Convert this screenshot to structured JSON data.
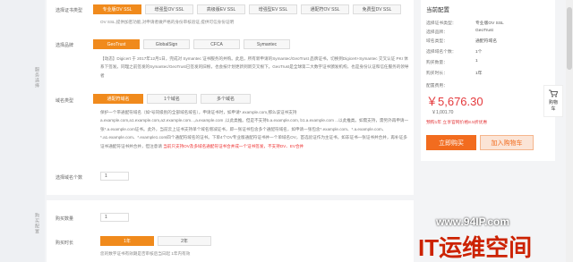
{
  "side": {
    "label_a": "服务选择",
    "label_b": "购买配置"
  },
  "cert_type": {
    "label": "选择证书类型",
    "options": [
      "专业版OV SSL",
      "增强型OV SSL",
      "高级版EV SSL",
      "增强型EV SSL",
      "通配符OV SSL",
      "免费型DV SSL"
    ],
    "selected": 0,
    "note": "OV SSL,提供加密功能,对申请者做严格的身份审核验证,提供可信身份证明"
  },
  "brand": {
    "label": "选择品牌",
    "options": [
      "GeoTrust",
      "GlobalSign",
      "CFCA",
      "Symantec"
    ],
    "selected": 0,
    "desc": "【动态】Digicert 于 2017年12月1日，完成对 Symantec 证书服务的并购。此后，所有新申请的Symantec/GeoTrust 品牌证书，切换到Digicert+Symantec 交叉认证 PKI 体系下签发。同理之前签发的Symantec/GeoTrust已签发的旧根，也会按计划更新到新交叉根下。GeoTrust是全球第二大数字证书颁发机构，也是身份认证和信任服务的领导者"
  },
  "domain_type": {
    "label": "域名类型",
    "options": [
      "通配符域名",
      "1个域名",
      "多个域名"
    ],
    "selected": 0,
    "desc_a": "保护一个带通配符域名（如*号同级别的全部域名域名），申请证书时，如申请*.example.com,那么该证书支持a.example.com,a1.example.com,a2.example.com...,a.example.com ,以此类推。但是不支持b.a.example.com, b1.a.example.com ...以此推类。如需支持，需另外再申请一张*.a.example.com证书。此外，当前云上证书支持单个域名增减证书，即一张证书包含多个通配符域名，如申请一张包含*.example.com、*.a.example.com、*.a1.example.com、*.example1.com四个通配符域名的证书。下单4个OV专业版通配符证书并一个单域名OV，首选验证作为主证书，如非证书一张证书并合并，再补证多证书通配符证书并合并，但注意请 ",
    "desc_red": "当前只支持OV及多域名通配符证书合并成一个证书签发，不支持DV、EV合并"
  },
  "domain_count": {
    "label": "选择域名个数",
    "value": "1"
  },
  "purchase_count": {
    "label": "购买数量",
    "value": "1"
  },
  "duration": {
    "label": "购买时长",
    "options": [
      "1年",
      "2年"
    ],
    "selected": 0,
    "note": "您的数字证书有效期是否审核后当日起 1年内有效"
  },
  "config": {
    "title": "当前配置",
    "rows": [
      {
        "k": "选择证书类型：",
        "v": "专业版OV SSL"
      },
      {
        "k": "选择品牌：",
        "v": "GeoTrust"
      },
      {
        "k": "域名类型：",
        "v": "通配符域名"
      },
      {
        "k": "选择域名个数：",
        "v": "1个"
      },
      {
        "k": "购买数量：",
        "v": "1"
      },
      {
        "k": "购买时长：",
        "v": "1年"
      },
      {
        "k": "配置费用：",
        "v": ""
      }
    ],
    "price": "￥5,676.30",
    "original_price": "￥1,001.70",
    "promo": "预购1年 立享官网价格8.5折优惠",
    "buy_label": "立即购买",
    "cart_label": "加入购物车"
  },
  "float_cart": {
    "label_a": "购物",
    "label_b": "车"
  },
  "watermark": {
    "url": "www.94IP.com",
    "text": "IT运维空间"
  },
  "colors": {
    "accent": "#f08a1c",
    "price": "#e4393c",
    "buy": "#f26c1f"
  }
}
